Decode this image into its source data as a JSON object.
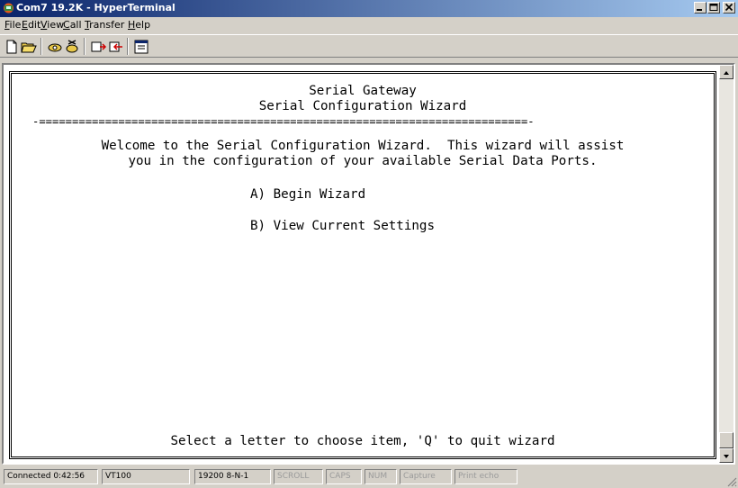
{
  "window": {
    "title": "Com7 19.2K - HyperTerminal"
  },
  "menu": [
    {
      "mnemonic": "F",
      "rest": "ile"
    },
    {
      "mnemonic": "E",
      "rest": "dit"
    },
    {
      "mnemonic": "V",
      "rest": "iew"
    },
    {
      "mnemonic": "C",
      "rest": "all"
    },
    {
      "mnemonic": "T",
      "rest": "ransfer"
    },
    {
      "mnemonic": "H",
      "rest": "elp"
    }
  ],
  "terminal": {
    "title1": "Serial Gateway",
    "title2": "Serial Configuration Wizard",
    "divider": "-==========================================================================-",
    "welcome1": "Welcome to the Serial Configuration Wizard.  This wizard will assist",
    "welcome2": "you in the configuration of your available Serial Data Ports.",
    "optionA": "A) Begin Wizard",
    "optionB": "B) View Current Settings",
    "prompt": "Select a letter to choose item, 'Q' to quit wizard"
  },
  "status": {
    "connected": "Connected 0:42:56",
    "emulation": "VT100",
    "settings": "19200 8-N-1",
    "scroll": "SCROLL",
    "caps": "CAPS",
    "num": "NUM",
    "capture": "Capture",
    "printecho": "Print echo"
  },
  "colors": {
    "titlebar_start": "#0a246a",
    "titlebar_end": "#a6caf0",
    "chrome": "#d4d0c8"
  }
}
